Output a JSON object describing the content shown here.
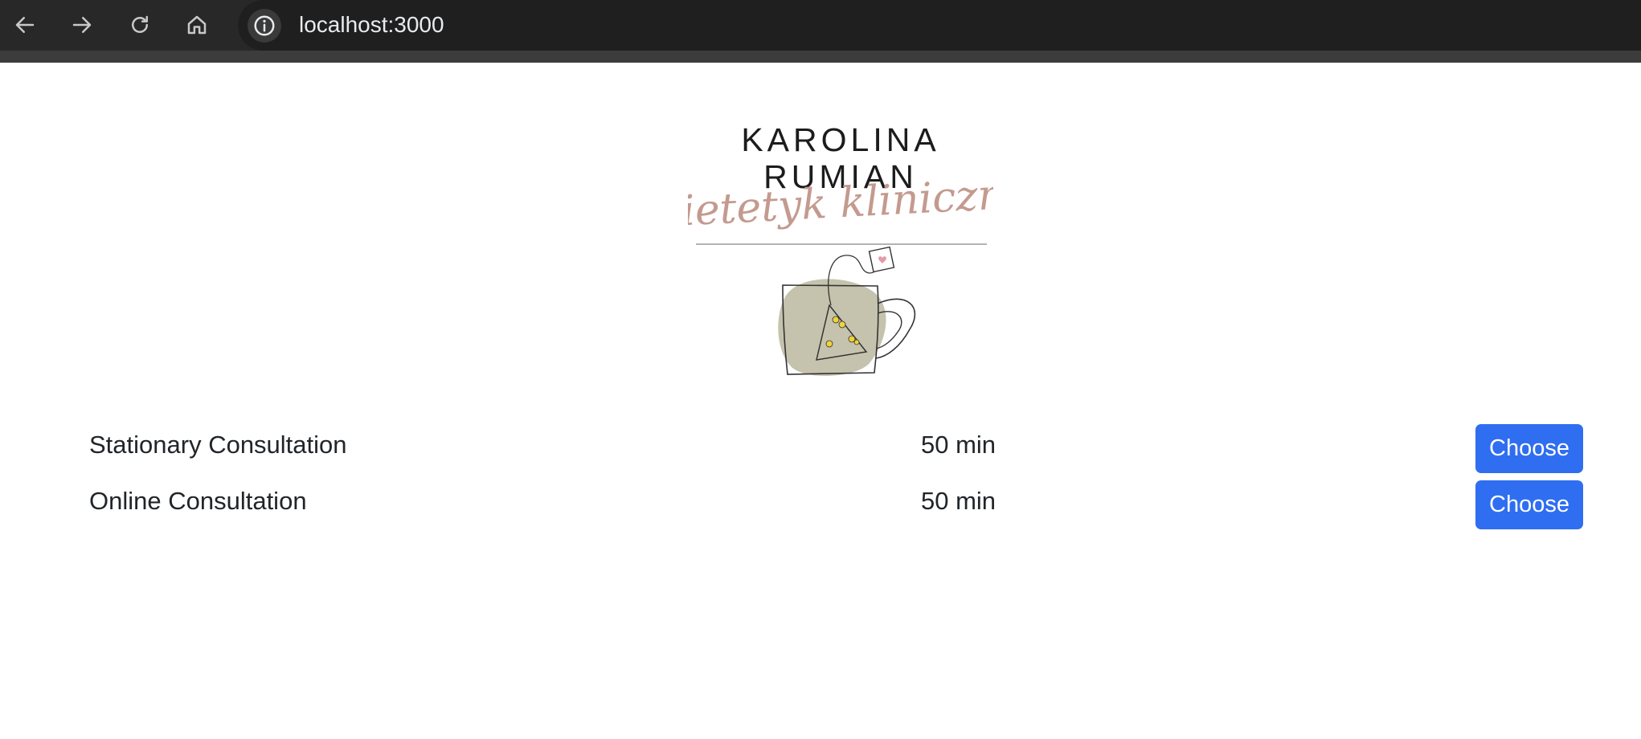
{
  "browser": {
    "url": "localhost:3000",
    "icons": {
      "back": "back-arrow-icon",
      "forward": "forward-arrow-icon",
      "reload": "reload-icon",
      "home": "home-icon",
      "site_info": "info-icon"
    }
  },
  "logo": {
    "name_line1": "KAROLINA",
    "name_line2": "RUMIAN",
    "tagline": "dietetyk kliniczny"
  },
  "services": [
    {
      "name": "Stationary Consultation",
      "duration": "50 min",
      "button_label": "Choose"
    },
    {
      "name": "Online Consultation",
      "duration": "50 min",
      "button_label": "Choose"
    }
  ],
  "colors": {
    "button_bg": "#2f6ef0",
    "text": "#212529",
    "toolbar_bg": "#282828",
    "logo_script": "#c49a8f",
    "logo_blob": "#c5c3ad"
  }
}
